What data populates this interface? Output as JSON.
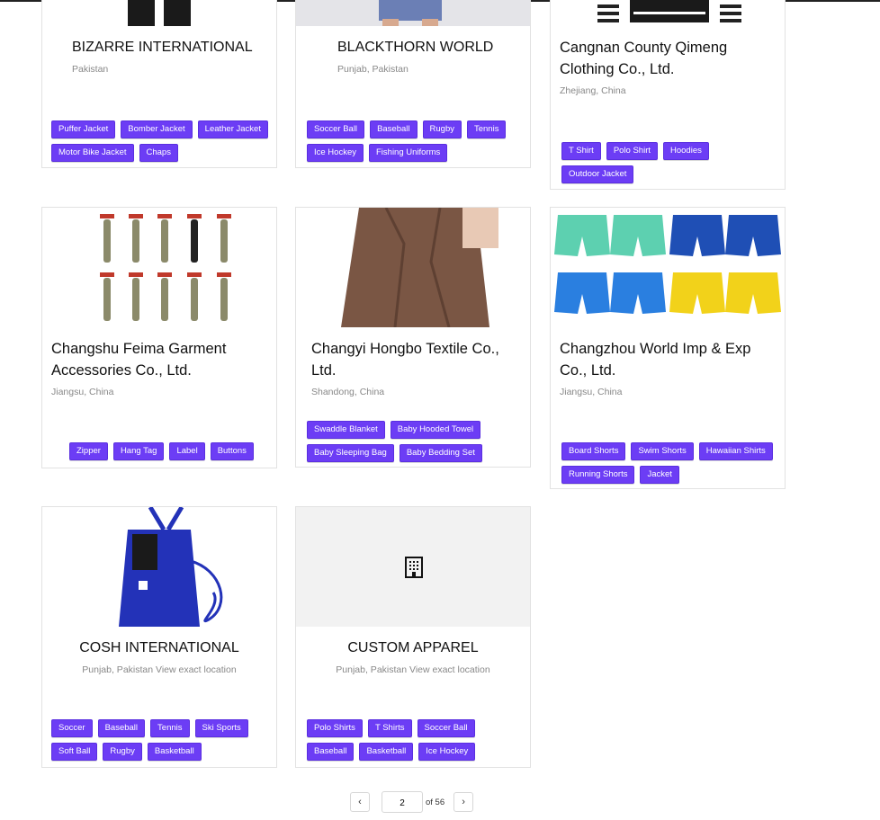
{
  "cards": [
    {
      "title": "BIZARRE INTERNATIONAL",
      "location": "Pakistan",
      "tags": [
        "Puffer Jacket",
        "Bomber Jacket",
        "Leather Jacket",
        "Motor Bike Jacket",
        "Chaps"
      ]
    },
    {
      "title": "BLACKTHORN WORLD",
      "location": "Punjab, Pakistan",
      "tags": [
        "Soccer Ball",
        "Baseball",
        "Rugby",
        "Tennis",
        "Ice Hockey",
        "Fishing Uniforms"
      ]
    },
    {
      "title": "Cangnan County Qimeng Clothing Co., Ltd.",
      "location": "Zhejiang, China",
      "tags": [
        "T Shirt",
        "Polo Shirt",
        "Hoodies",
        "Outdoor Jacket"
      ]
    },
    {
      "title": "Changshu Feima Garment Accessories Co., Ltd.",
      "location": "Jiangsu, China",
      "tags": [
        "Zipper",
        "Hang Tag",
        "Label",
        "Buttons"
      ]
    },
    {
      "title": "Changyi Hongbo Textile Co., Ltd.",
      "location": "Shandong, China",
      "tags": [
        "Swaddle Blanket",
        "Baby Hooded Towel",
        "Baby Sleeping Bag",
        "Baby Bedding Set"
      ]
    },
    {
      "title": "Changzhou World Imp & Exp Co., Ltd.",
      "location": "Jiangsu, China",
      "tags": [
        "Board Shorts",
        "Swim Shorts",
        "Hawaiian Shirts",
        "Running Shorts",
        "Jacket"
      ]
    },
    {
      "title": "COSH INTERNATIONAL",
      "location": "Punjab, Pakistan View exact location",
      "tags": [
        "Soccer",
        "Baseball",
        "Tennis",
        "Ski Sports",
        "Soft Ball",
        "Rugby",
        "Basketball"
      ]
    },
    {
      "title": "CUSTOM APPAREL",
      "location": "Punjab, Pakistan View exact location",
      "tags": [
        "Polo Shirts",
        "T Shirts",
        "Soccer Ball",
        "Baseball",
        "Basketball",
        "Ice Hockey"
      ]
    }
  ],
  "pagination": {
    "prev_icon": "chevron-left-icon",
    "next_icon": "chevron-right-icon",
    "prev": "‹",
    "next": "›",
    "current_page": "2",
    "of_label": "of 56"
  },
  "colors": {
    "tag": "#6c3df5"
  }
}
